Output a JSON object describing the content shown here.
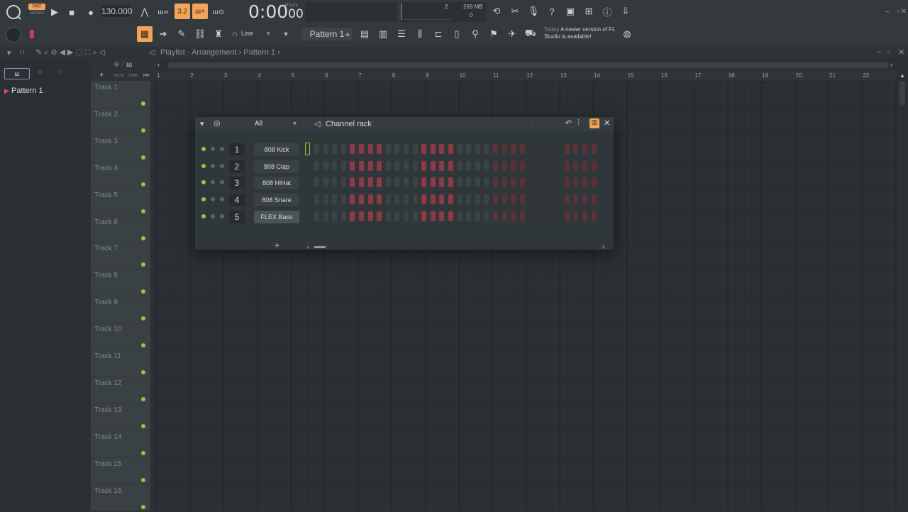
{
  "toolbar": {
    "pat_label": "PAT",
    "song_label": "SONG",
    "tempo": "130.000",
    "time": "0:00",
    "time_sub": "00",
    "time_unit": "M:S:CS",
    "pattern_name": "Pattern 1",
    "snap_mode": "Line",
    "cpu_value": "2",
    "memory": "269 MB",
    "polyphony": "0",
    "news_date": "Today",
    "news_text": "A newer version of FL Studio is available!"
  },
  "playlist": {
    "breadcrumb": "Playlist - Arrangement › Pattern 1 ›",
    "ruler": [
      "1",
      "2",
      "3",
      "4",
      "5",
      "6",
      "7",
      "8",
      "9",
      "10",
      "11",
      "12",
      "13",
      "14",
      "15",
      "16",
      "17",
      "18",
      "19",
      "20",
      "21",
      "22"
    ],
    "tracks": [
      "Track 1",
      "Track 2",
      "Track 3",
      "Track 4",
      "Track 5",
      "Track 6",
      "Track 7",
      "Track 8",
      "Track 9",
      "Track 10",
      "Track 11",
      "Track 12",
      "Track 13",
      "Track 14",
      "Track 15",
      "Track 16"
    ],
    "header_tabs": [
      "NOTE",
      "CHAN",
      "PAT"
    ]
  },
  "browser": {
    "items": [
      "Pattern 1"
    ]
  },
  "channel_rack": {
    "title": "Channel rack",
    "filter": "All",
    "channels": [
      {
        "num": "1",
        "name": "808 Kick"
      },
      {
        "num": "2",
        "name": "808 Clap"
      },
      {
        "num": "3",
        "name": "808 HiHat"
      },
      {
        "num": "4",
        "name": "808 Snare"
      },
      {
        "num": "5",
        "name": "FLEX Bass"
      }
    ],
    "add_label": "+"
  },
  "colors": {
    "accent": "#f2a55a",
    "step_red": "#8e3a46",
    "step_dark": "#3b4346",
    "led_green": "#9ec43b"
  }
}
